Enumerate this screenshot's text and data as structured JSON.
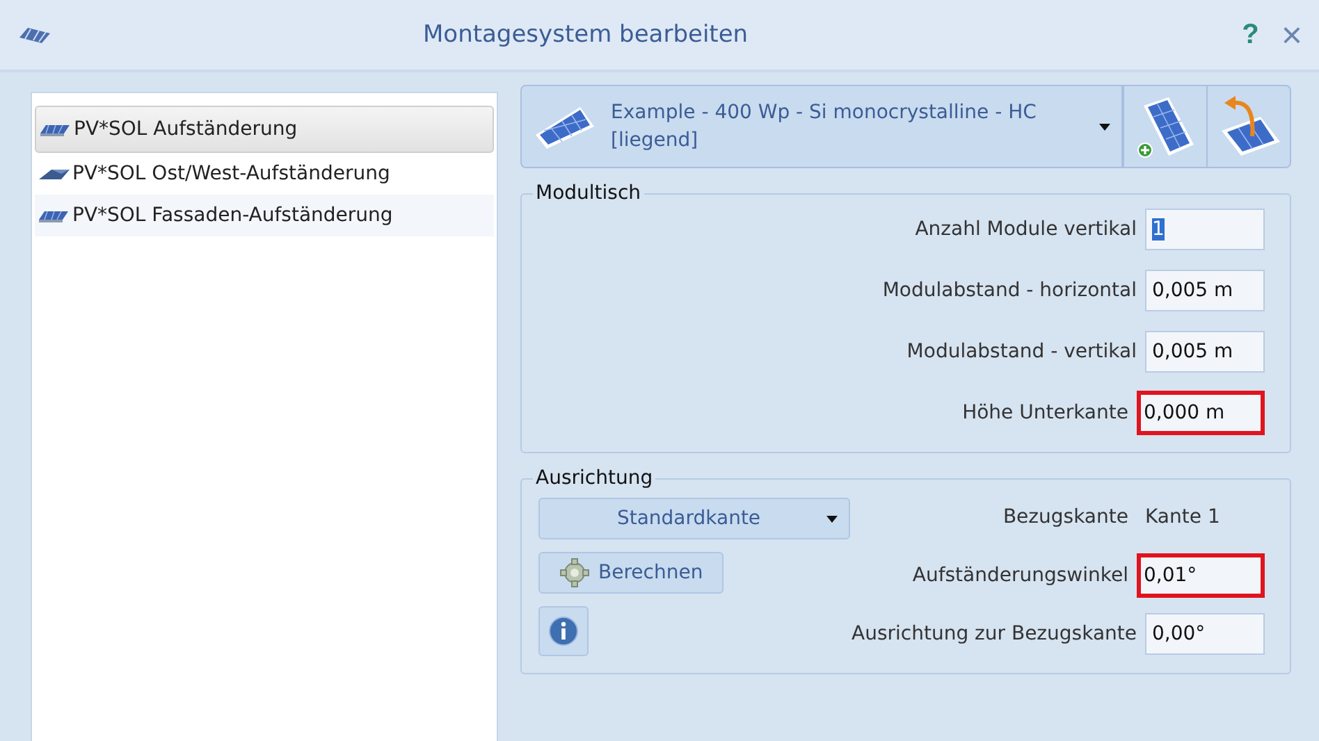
{
  "window": {
    "title": "Montagesystem bearbeiten",
    "help": "?",
    "close": "×"
  },
  "systems": [
    {
      "label": "PV*SOL Aufständerung",
      "selected": true,
      "kind": "tilted"
    },
    {
      "label": "PV*SOL Ost/West-Aufständerung",
      "selected": false,
      "kind": "eastwest"
    },
    {
      "label": "PV*SOL Fassaden-Aufständerung",
      "selected": false,
      "kind": "tilted"
    }
  ],
  "module": {
    "name": "Example - 400 Wp - Si monocrystalline - HC [liegend]"
  },
  "modultisch": {
    "title": "Modultisch",
    "fields": [
      {
        "label": "Anzahl Module vertikal",
        "value": "1",
        "text_selected": true,
        "highlighted": false
      },
      {
        "label": "Modulabstand - horizontal",
        "value": "0,005 m",
        "text_selected": false,
        "highlighted": false
      },
      {
        "label": "Modulabstand - vertikal",
        "value": "0,005 m",
        "text_selected": false,
        "highlighted": false
      },
      {
        "label": "Höhe Unterkante",
        "value": "0,000 m",
        "text_selected": false,
        "highlighted": true
      }
    ]
  },
  "ausrichtung": {
    "title": "Ausrichtung",
    "dropdown": "Standardkante",
    "calc_button": "Berechnen",
    "reference_label": "Bezugskante",
    "reference_value": "Kante 1",
    "fields": [
      {
        "label": "Aufständerungswinkel",
        "value": "0,01°",
        "text_selected": false,
        "highlighted": true
      },
      {
        "label": "Ausrichtung zur Bezugskante",
        "value": "0,00°",
        "text_selected": false,
        "highlighted": false
      }
    ]
  }
}
